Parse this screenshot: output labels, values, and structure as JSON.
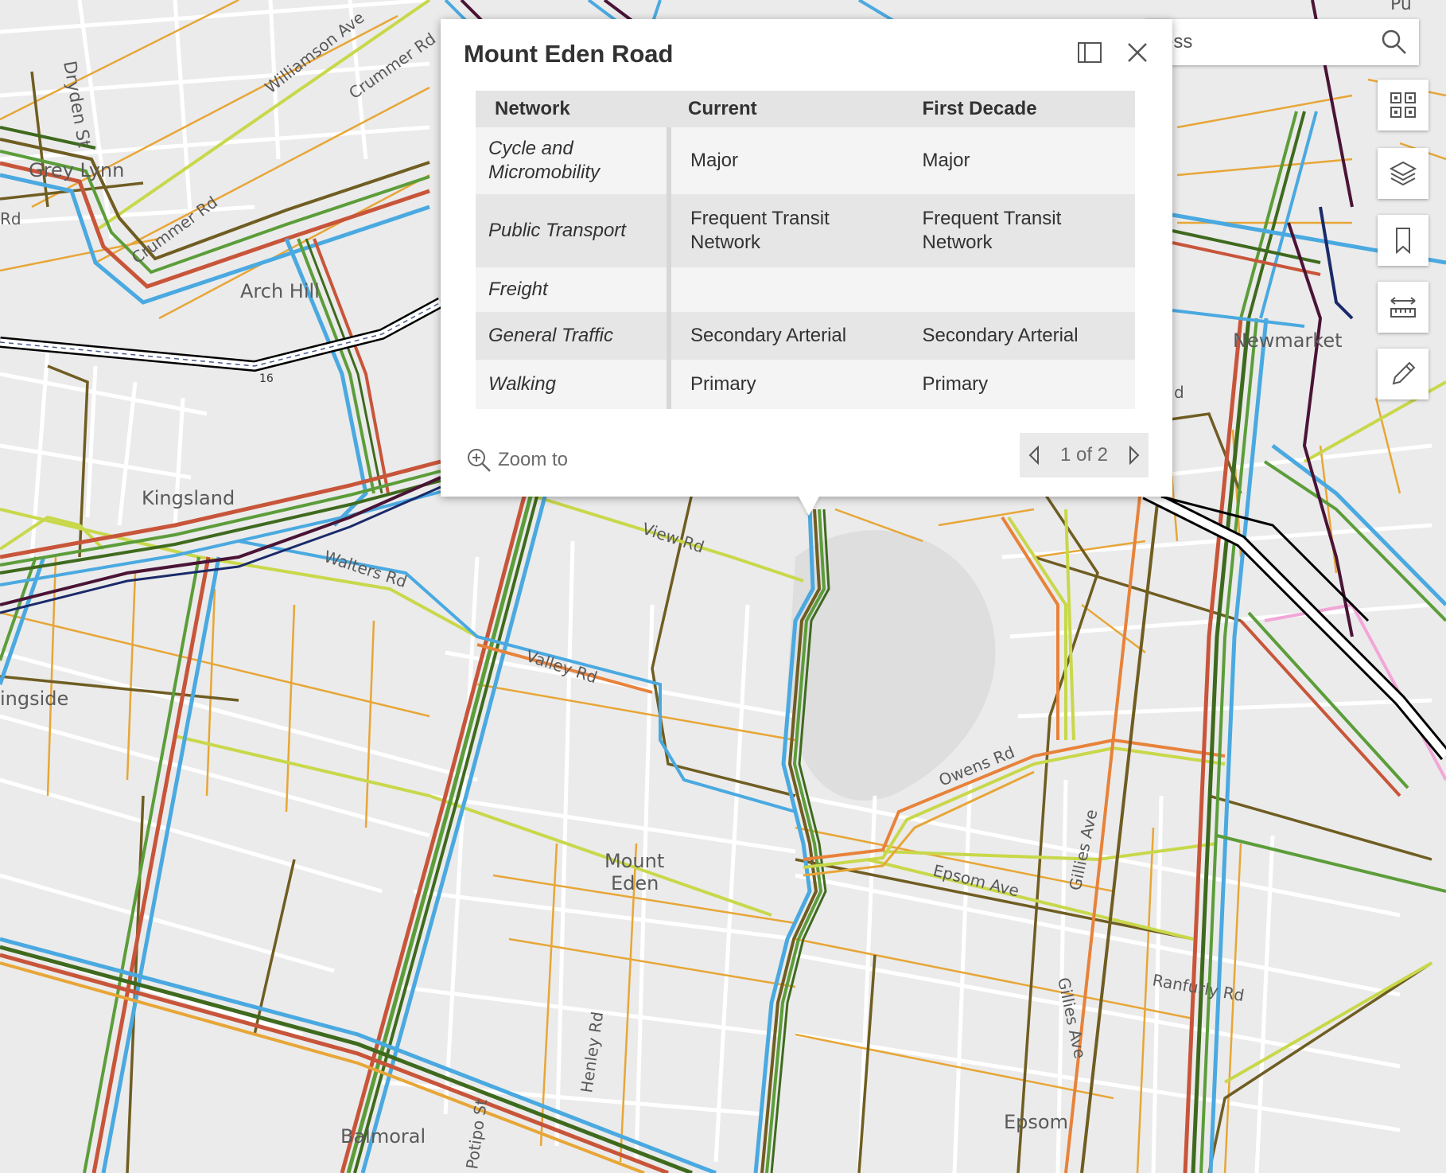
{
  "map": {
    "labels": {
      "dryden": "Dryden St",
      "williamson": "Williamson Ave",
      "crummer1": "Crummer Rd",
      "crummer2": "Crummer Rd",
      "greylynn": "Grey Lynn",
      "rd_left": "Rd",
      "archhill": "Arch Hill",
      "hw16": "16",
      "kingsland": "Kingsland",
      "walters": "Walters Rd",
      "viewrd": "View Rd",
      "valley": "Valley Rd",
      "kingside": "ingside",
      "mounteden1": "Mount",
      "mounteden2": "Eden",
      "owens": "Owens Rd",
      "epsom_ave": "Epsom Ave",
      "gillies1": "Gillies Ave",
      "gillies2": "Gillies Ave",
      "ranfurly": "Ranfurly Rd",
      "henley": "Henley Rd",
      "epsom": "Epsom",
      "balmoral": "Balmoral",
      "potipo": "Potipo St",
      "newmarket": "Newmarket",
      "rd_right": "d",
      "pu": "Pu"
    }
  },
  "search": {
    "placeholder": "Find address",
    "value": "ess"
  },
  "popup": {
    "title": "Mount Eden Road",
    "columns": [
      "Network",
      "Current",
      "First Decade"
    ],
    "rows": [
      {
        "network": "Cycle and Micromobility",
        "current": "Major",
        "first_decade": "Major"
      },
      {
        "network": "Public Transport",
        "current": "Frequent Transit Network",
        "first_decade": "Frequent Transit Network"
      },
      {
        "network": "Freight",
        "current": "",
        "first_decade": ""
      },
      {
        "network": "General Traffic",
        "current": "Secondary Arterial",
        "first_decade": "Secondary Arterial"
      },
      {
        "network": "Walking",
        "current": "Primary",
        "first_decade": "Primary"
      }
    ],
    "zoom_to": "Zoom to",
    "pager": "1 of 2"
  },
  "toolbar": [
    "qr-grid-icon",
    "layers-icon",
    "bookmark-icon",
    "measure-icon",
    "sketch-pencil-icon"
  ],
  "colors": {
    "cycle": "#c8d84a",
    "walking": "#e7a637",
    "traffic": "#e8823a",
    "freight": "#6f5d22",
    "transit": "#4aa9e0",
    "green": "#5c9d3a",
    "darkgreen": "#3f6a1e",
    "red": "#c8553a",
    "rail": "#4a1436",
    "navy": "#1a2a6a"
  }
}
